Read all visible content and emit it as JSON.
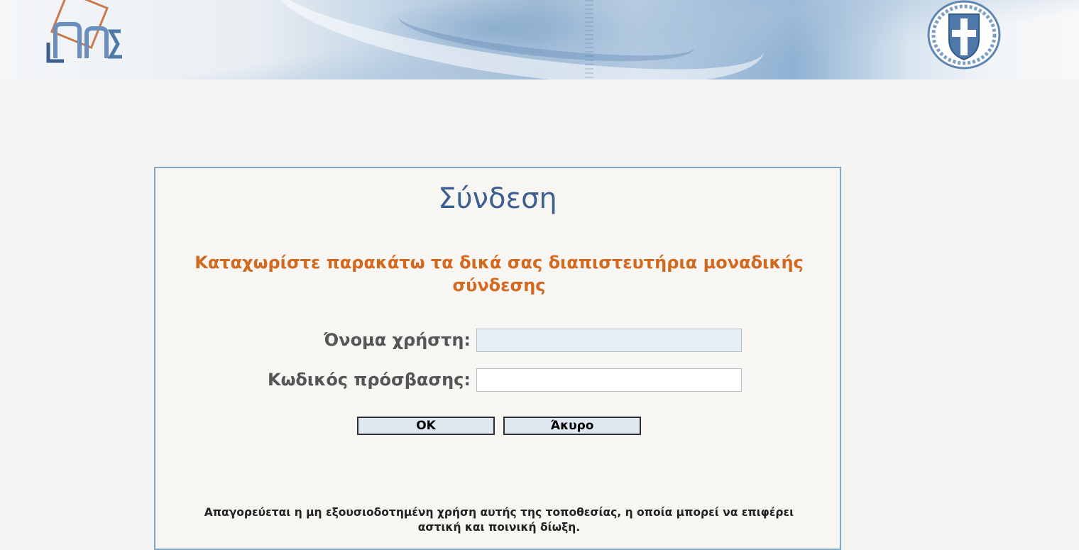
{
  "header": {
    "left_logo_icon": "gsis-logo-icon",
    "right_logo_icon": "greek-coat-of-arms-icon"
  },
  "login": {
    "title": "Σύνδεση",
    "instructions": "Καταχωρίστε παρακάτω τα δικά σας διαπιστευτήρια μοναδικής σύνδεσης",
    "username_label": "Όνομα χρήστη:",
    "username_value": "",
    "password_label": "Κωδικός πρόσβασης:",
    "password_value": "",
    "ok_label": "OK",
    "cancel_label": "Άκυρο",
    "disclaimer": "Απαγορεύεται η μη εξουσιοδοτημένη χρήση αυτής της τοποθεσίας, η οποία μπορεί να επιφέρει αστική και ποινική δίωξη."
  },
  "colors": {
    "title": "#3d5f8f",
    "instructions": "#d2691e",
    "box_border": "#7fa8c8",
    "background": "#f3f3f2"
  }
}
